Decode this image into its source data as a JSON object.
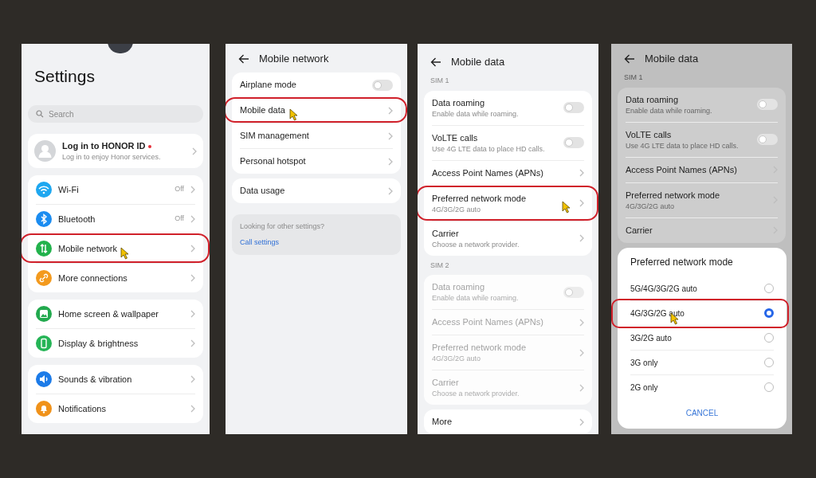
{
  "panels": [
    {
      "header": {
        "kind": "large",
        "title": "Settings"
      },
      "search": {
        "placeholder": "Search"
      },
      "groups": [
        {
          "rows": [
            {
              "kind": "account",
              "label": "Log in to HONOR ID",
              "subtitle": "Log in to enjoy Honor services.",
              "badge": true
            }
          ]
        },
        {
          "rows": [
            {
              "kind": "nav",
              "icon": true,
              "label": "Wi-Fi",
              "value": "Off"
            },
            {
              "kind": "nav",
              "icon": true,
              "label": "Bluetooth",
              "value": "Off"
            },
            {
              "kind": "nav",
              "icon": true,
              "label": "Mobile network",
              "highlighted": true,
              "cursor": true
            },
            {
              "kind": "nav",
              "icon": true,
              "label": "More connections"
            }
          ]
        },
        {
          "rows": [
            {
              "kind": "nav",
              "icon": true,
              "label": "Home screen & wallpaper"
            },
            {
              "kind": "nav",
              "icon": true,
              "label": "Display & brightness"
            }
          ]
        },
        {
          "rows": [
            {
              "kind": "nav",
              "icon": true,
              "label": "Sounds & vibration"
            },
            {
              "kind": "nav",
              "icon": true,
              "label": "Notifications"
            }
          ]
        }
      ]
    },
    {
      "header": {
        "kind": "back",
        "title": "Mobile network"
      },
      "groups": [
        {
          "rows": [
            {
              "kind": "toggle",
              "label": "Airplane mode",
              "on": false
            },
            {
              "kind": "nav",
              "label": "Mobile data",
              "highlighted": true,
              "cursor": true
            },
            {
              "kind": "nav",
              "label": "SIM management"
            },
            {
              "kind": "nav",
              "label": "Personal hotspot"
            }
          ]
        },
        {
          "rows": [
            {
              "kind": "nav",
              "label": "Data usage"
            }
          ]
        },
        {
          "kind": "note",
          "note": "Looking for other settings?",
          "link": "Call settings"
        }
      ]
    },
    {
      "header": {
        "kind": "back",
        "title": "Mobile data"
      },
      "groups": [
        {
          "heading": "SIM 1",
          "rows": [
            {
              "kind": "toggle",
              "label": "Data roaming",
              "subtitle": "Enable data while roaming.",
              "on": false
            },
            {
              "kind": "toggle",
              "label": "VoLTE calls",
              "subtitle": "Use 4G LTE data to place HD calls.",
              "on": false
            },
            {
              "kind": "nav",
              "label": "Access Point Names (APNs)"
            },
            {
              "kind": "nav",
              "label": "Preferred network mode",
              "subtitle": "4G/3G/2G auto",
              "highlighted": true,
              "cursor": true
            },
            {
              "kind": "nav",
              "label": "Carrier",
              "subtitle": "Choose a network provider."
            }
          ]
        },
        {
          "heading": "SIM 2",
          "disabled": true,
          "rows": [
            {
              "kind": "toggle",
              "label": "Data roaming",
              "subtitle": "Enable data while roaming.",
              "on": false
            },
            {
              "kind": "nav",
              "label": "Access Point Names (APNs)"
            },
            {
              "kind": "nav",
              "label": "Preferred network mode",
              "subtitle": "4G/3G/2G auto"
            },
            {
              "kind": "nav",
              "label": "Carrier",
              "subtitle": "Choose a network provider."
            }
          ]
        },
        {
          "rows": [
            {
              "kind": "nav",
              "label": "More"
            }
          ]
        }
      ]
    },
    {
      "header": {
        "kind": "back",
        "title": "Mobile data"
      },
      "groups": [
        {
          "heading": "SIM 1",
          "rows": [
            {
              "kind": "toggle",
              "label": "Data roaming",
              "subtitle": "Enable data while roaming.",
              "on": false
            },
            {
              "kind": "toggle",
              "label": "VoLTE calls",
              "subtitle": "Use 4G LTE data to place HD calls.",
              "on": false
            },
            {
              "kind": "nav",
              "label": "Access Point Names (APNs)"
            },
            {
              "kind": "nav",
              "label": "Preferred network mode",
              "subtitle": "4G/3G/2G auto"
            },
            {
              "kind": "nav",
              "label": "Carrier"
            }
          ]
        }
      ],
      "dialog": {
        "title": "Preferred network mode",
        "options": [
          {
            "label": "5G/4G/3G/2G auto",
            "selected": false
          },
          {
            "label": "4G/3G/2G auto",
            "selected": true,
            "highlighted": true,
            "cursor": true
          },
          {
            "label": "3G/2G auto",
            "selected": false
          },
          {
            "label": "3G only",
            "selected": false
          },
          {
            "label": "2G only",
            "selected": false
          }
        ],
        "cancel": "CANCEL"
      }
    }
  ]
}
